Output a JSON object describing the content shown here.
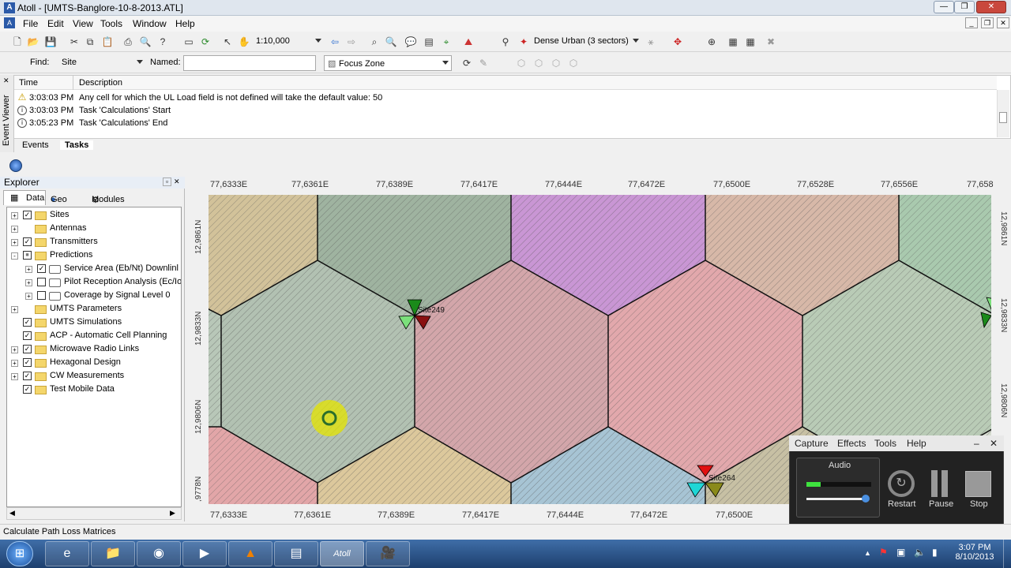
{
  "window": {
    "title": "Atoll - [UMTS-Banglore-10-8-2013.ATL]"
  },
  "menu": [
    "File",
    "Edit",
    "View",
    "Tools",
    "Window",
    "Help"
  ],
  "toolbar1": {
    "scale": "1:10,000",
    "environment": "Dense Urban (3 sectors)"
  },
  "toolbar2": {
    "find_label": "Find:",
    "find_value": "Site",
    "named_label": "Named:",
    "named_value": "",
    "zone": "Focus Zone"
  },
  "event_viewer": {
    "side_label": "Event Viewer",
    "col_time": "Time",
    "col_desc": "Description",
    "rows": [
      {
        "icon": "warning-icon",
        "time": "3:03:03 PM",
        "desc": "Any cell for which the UL Load field is not defined will take the default value: 50"
      },
      {
        "icon": "info-icon",
        "time": "3:03:03 PM",
        "desc": "Task 'Calculations' Start"
      },
      {
        "icon": "info-icon",
        "time": "3:05:23 PM",
        "desc": "Task 'Calculations' End"
      }
    ],
    "tabs": [
      "Events",
      "Tasks"
    ]
  },
  "explorer": {
    "title": "Explorer",
    "tabs": [
      "Data",
      "Geo",
      "Modules"
    ],
    "tree": [
      {
        "label": "Sites",
        "level": 0,
        "expander": "+",
        "checked": "on",
        "folder": true
      },
      {
        "label": "Antennas",
        "level": 0,
        "expander": "+",
        "checked": "none",
        "folder": true
      },
      {
        "label": "Transmitters",
        "level": 0,
        "expander": "+",
        "checked": "on",
        "folder": true
      },
      {
        "label": "Predictions",
        "level": 0,
        "expander": "-",
        "checked": "partial",
        "folder": true
      },
      {
        "label": "Service Area (Eb/Nt) Downlinl",
        "level": 1,
        "expander": "+",
        "checked": "on",
        "folder": false
      },
      {
        "label": "Pilot Reception Analysis (Ec/Io",
        "level": 1,
        "expander": "+",
        "checked": "off",
        "folder": false
      },
      {
        "label": "Coverage by Signal Level 0",
        "level": 1,
        "expander": "+",
        "checked": "off",
        "folder": false
      },
      {
        "label": "UMTS Parameters",
        "level": 0,
        "expander": "+",
        "checked": "none",
        "folder": true
      },
      {
        "label": "UMTS Simulations",
        "level": 0,
        "expander": "",
        "checked": "on",
        "folder": true
      },
      {
        "label": "ACP - Automatic Cell Planning",
        "level": 0,
        "expander": "",
        "checked": "on",
        "folder": true
      },
      {
        "label": "Microwave Radio Links",
        "level": 0,
        "expander": "+",
        "checked": "on",
        "folder": true
      },
      {
        "label": "Hexagonal Design",
        "level": 0,
        "expander": "+",
        "checked": "on",
        "folder": true
      },
      {
        "label": "CW Measurements",
        "level": 0,
        "expander": "+",
        "checked": "on",
        "folder": true
      },
      {
        "label": "Test Mobile Data",
        "level": 0,
        "expander": "",
        "checked": "on",
        "folder": true
      }
    ]
  },
  "map": {
    "top_coords": [
      "77,6333E",
      "77,6361E",
      "77,6389E",
      "77,6417E",
      "77,6444E",
      "77,6472E",
      "77,6500E",
      "77,6528E",
      "77,6556E",
      "77,658"
    ],
    "bottom_coords": [
      "77,6333E",
      "77,6361E",
      "77,6389E",
      "77,6417E",
      "77,6444E",
      "77,6472E",
      "77,6500E"
    ],
    "left_coords": [
      "12,9861N",
      "12,9833N",
      "12,9806N",
      ",9778N"
    ],
    "right_coords": [
      "12,9861N",
      "12,9833N",
      "12,9806N"
    ],
    "sites": [
      "Site249",
      "Site264"
    ]
  },
  "capture_widget": {
    "menu": [
      "Capture",
      "Effects",
      "Tools",
      "Help"
    ],
    "audio_label": "Audio",
    "buttons": [
      "Restart",
      "Pause",
      "Stop"
    ]
  },
  "status": {
    "text": "Calculate Path Loss Matrices"
  },
  "taskbar": {
    "time": "3:07 PM",
    "date": "8/10/2013"
  }
}
